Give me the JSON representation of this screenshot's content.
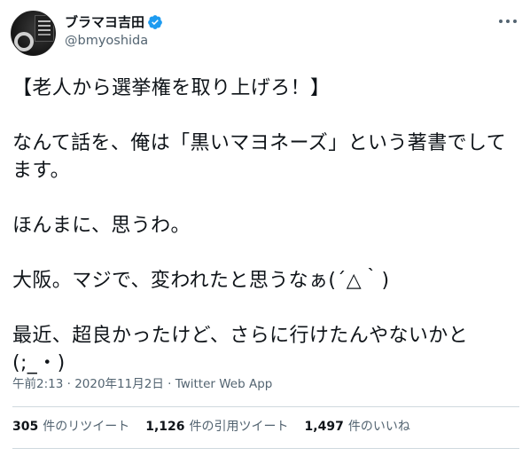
{
  "author": {
    "display_name": "ブラマヨ吉田",
    "handle": "@bmyoshida",
    "verified": true
  },
  "tweet": {
    "lines": [
      "【老人から選挙権を取り上げろ！】",
      "",
      "なんて話を、俺は「黒いマヨネーズ」という著書でしてます。",
      "",
      "ほんまに、思うわ。",
      "",
      "大阪。マジで、変われたと思うなぁ(´△｀)",
      "",
      "最近、超良かったけど、さらに行けたんやないかと(;_・)"
    ]
  },
  "meta": {
    "time": "午前2:13",
    "separator": " · ",
    "date": "2020年11月2日",
    "source": "Twitter Web App"
  },
  "stats": [
    {
      "count": "305",
      "label": "件のリツイート"
    },
    {
      "count": "1,126",
      "label": "件の引用ツイート"
    },
    {
      "count": "1,497",
      "label": "件のいいね"
    }
  ],
  "icons": {
    "verified": "verified-badge-icon",
    "more": "more-horizontal-icon"
  },
  "colors": {
    "verified_blue": "#1d9bf0",
    "secondary_text": "#536471",
    "divider": "#cfd9de"
  }
}
